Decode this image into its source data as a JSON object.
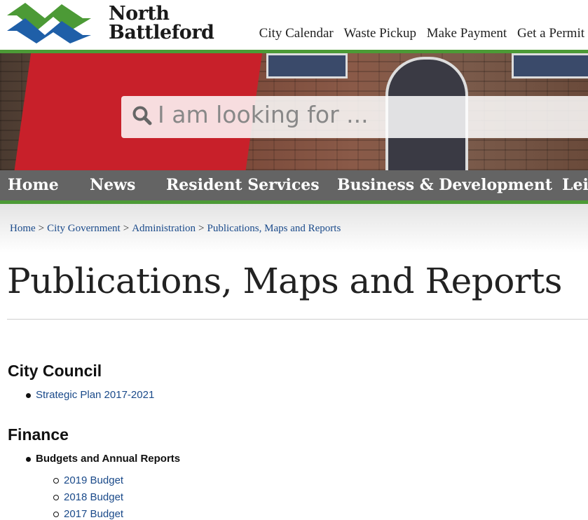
{
  "header": {
    "logo_line1": "North",
    "logo_line2": "Battleford",
    "util_nav": [
      "City Calendar",
      "Waste Pickup",
      "Make Payment",
      "Get a Permit"
    ]
  },
  "hero": {
    "search_placeholder": "I am looking for ..."
  },
  "main_nav": [
    "Home",
    "News",
    "Resident Services",
    "Business & Development",
    "Leisure"
  ],
  "breadcrumb": [
    "Home",
    "City Government",
    "Administration",
    "Publications, Maps and Reports"
  ],
  "breadcrumb_sep": ">",
  "page_title": "Publications, Maps and Reports",
  "sections": {
    "council": {
      "heading": "City Council",
      "items": [
        "Strategic Plan 2017-2021"
      ]
    },
    "finance": {
      "heading": "Finance",
      "group_label": "Budgets and Annual Reports",
      "sub_items": [
        "2019 Budget",
        "2018 Budget",
        "2017 Budget"
      ]
    }
  },
  "colors": {
    "brand_green": "#4c9a36",
    "brand_blue": "#1f5fa8",
    "link": "#1a4a8a"
  }
}
